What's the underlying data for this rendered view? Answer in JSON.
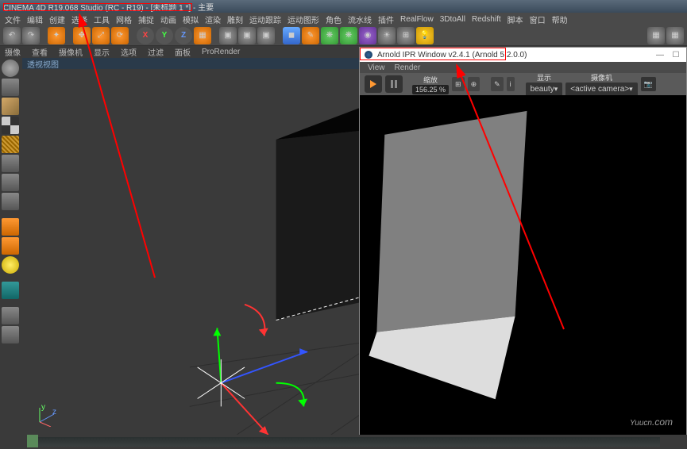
{
  "title": "CINEMA 4D R19.068 Studio (RC - R19) - [未标题 1 *] - 主要",
  "menu": [
    "文件",
    "编辑",
    "创建",
    "选择",
    "工具",
    "网格",
    "捕捉",
    "动画",
    "模拟",
    "渲染",
    "雕刻",
    "运动跟踪",
    "运动图形",
    "角色",
    "流水线",
    "插件",
    "RealFlow",
    "3DtoAll",
    "Redshift",
    "脚本",
    "窗口",
    "帮助"
  ],
  "sub_menu": [
    "摄像",
    "查看",
    "摄像机",
    "显示",
    "选项",
    "过滤",
    "面板",
    "ProRender"
  ],
  "viewport_title": "透视视图",
  "arnold": {
    "title": "Arnold IPR Window v2.4.1 (Arnold 5.2.0.0)",
    "menu": [
      "View",
      "Render"
    ],
    "labels": {
      "zoom": "缩放",
      "zoom_value": "156.25 %",
      "display": "显示",
      "camera": "摄像机",
      "beauty": "beauty",
      "active_camera": "<active camera>"
    },
    "win_buttons": {
      "min": "—",
      "max": "☐",
      "close": ""
    }
  },
  "axis": {
    "y": "y",
    "z": "z",
    "x": ""
  },
  "watermark": {
    "main": "Yuucn",
    "suffix": ".com"
  },
  "toolbar_icons": [
    "undo",
    "redo",
    "select",
    "live",
    "move",
    "scale",
    "rotate",
    "x",
    "y",
    "z",
    "history",
    "render",
    "render-region",
    "render-settings",
    "cube-add",
    "pen",
    "deformer",
    "environment",
    "camera",
    "light",
    "tag",
    "bulb"
  ]
}
